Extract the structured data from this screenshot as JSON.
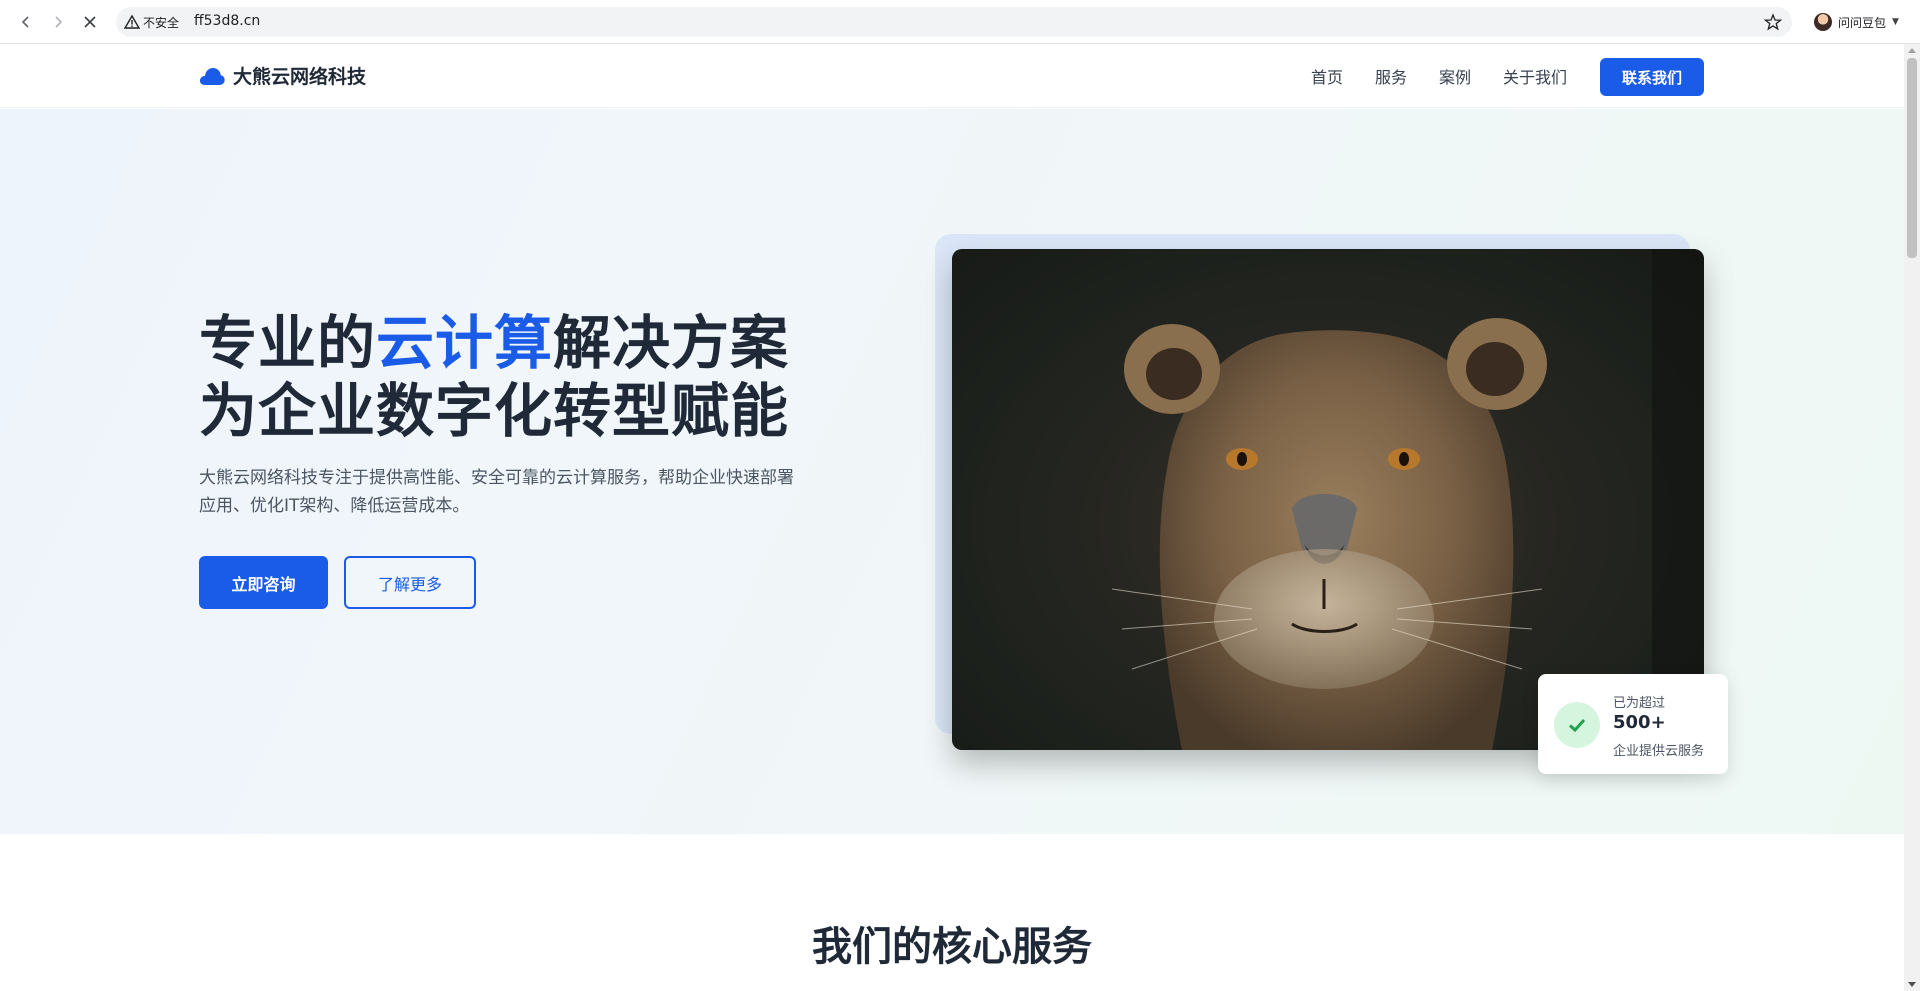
{
  "browser": {
    "insecure_label": "不安全",
    "url": "ff53d8.cn",
    "profile_name": "问问豆包"
  },
  "header": {
    "brand": "大熊云网络科技",
    "nav": [
      "首页",
      "服务",
      "案例",
      "关于我们"
    ],
    "contact_button": "联系我们"
  },
  "hero": {
    "headline_part1": "专业的",
    "headline_accent": "云计算",
    "headline_part2": "解决方案",
    "headline_line2": "为企业数字化转型赋能",
    "description": "大熊云网络科技专注于提供高性能、安全可靠的云计算服务，帮助企业快速部署应用、优化IT架构、降低运营成本。",
    "primary_button": "立即咨询",
    "secondary_button": "了解更多",
    "stat": {
      "line1": "已为超过",
      "number": "500+",
      "line2": "企业提供云服务"
    }
  },
  "services": {
    "title": "我们的核心服务"
  },
  "colors": {
    "brand_blue": "#1a5ce8",
    "check_green": "#22a34a"
  },
  "icons": [
    "back-icon",
    "forward-icon",
    "stop-icon",
    "warning-icon",
    "star-icon",
    "cloud-icon",
    "check-icon"
  ]
}
